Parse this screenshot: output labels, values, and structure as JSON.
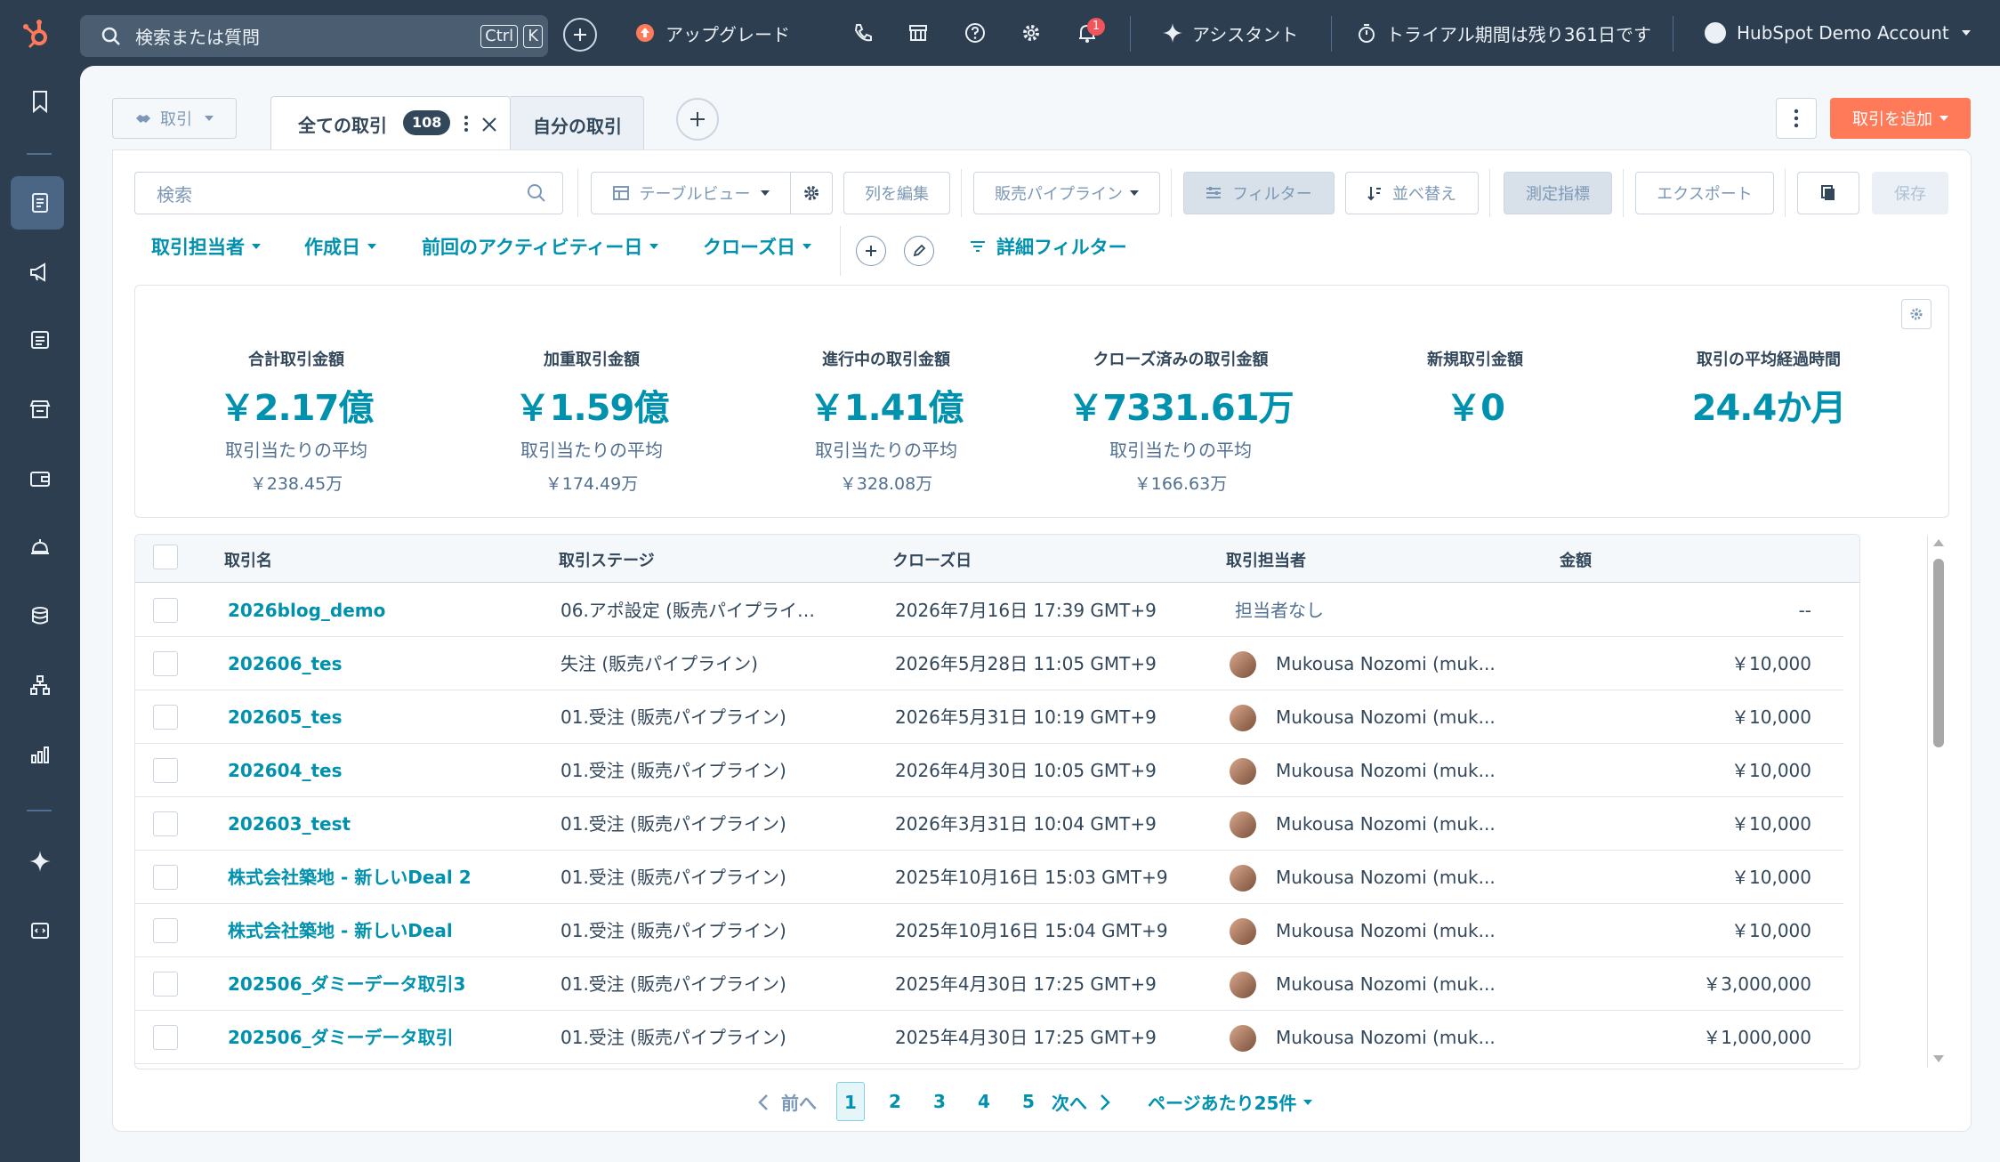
{
  "topbar": {
    "search_placeholder": "検索または質問",
    "kbd_ctrl": "Ctrl",
    "kbd_k": "K",
    "upgrade_label": "アップグレード",
    "notification_count": "1",
    "assistant_label": "アシスタント",
    "trial_label": "トライアル期間は残り361日です",
    "account_label": "HubSpot Demo Account"
  },
  "header": {
    "object_selector": "取引",
    "tabs": [
      {
        "label": "全ての取引",
        "count": "108"
      },
      {
        "label": "自分の取引"
      }
    ],
    "add_button": "取引を追加"
  },
  "toolbar": {
    "search_placeholder": "検索",
    "table_view": "テーブルビュー",
    "edit_columns": "列を編集",
    "pipeline": "販売パイプライン",
    "filter": "フィルター",
    "sort": "並べ替え",
    "metrics": "測定指標",
    "export": "エクスポート",
    "save": "保存"
  },
  "filters": {
    "owner": "取引担当者",
    "created": "作成日",
    "last_activity": "前回のアクティビティー日",
    "close_date": "クローズ日",
    "advanced": "詳細フィルター"
  },
  "kpis": [
    {
      "label": "合計取引金額",
      "value": "￥2.17億",
      "sub": "取引当たりの平均",
      "avg": "￥238.45万"
    },
    {
      "label": "加重取引金額",
      "value": "￥1.59億",
      "sub": "取引当たりの平均",
      "avg": "￥174.49万"
    },
    {
      "label": "進行中の取引金額",
      "value": "￥1.41億",
      "sub": "取引当たりの平均",
      "avg": "￥328.08万"
    },
    {
      "label": "クローズ済みの取引金額",
      "value": "￥7331.61万",
      "sub": "取引当たりの平均",
      "avg": "￥166.63万"
    },
    {
      "label": "新規取引金額",
      "value": "￥0",
      "sub": "",
      "avg": ""
    },
    {
      "label": "取引の平均経過時間",
      "value": "24.4か月",
      "sub": "",
      "avg": ""
    }
  ],
  "table": {
    "headers": {
      "name": "取引名",
      "stage": "取引ステージ",
      "close": "クローズ日",
      "owner": "取引担当者",
      "amount": "金額"
    },
    "rows": [
      {
        "name": "2026blog_demo",
        "stage": "06.アポ設定 (販売パイプライ…",
        "close": "2026年7月16日 17:39 GMT+9",
        "owner": "担当者なし",
        "amount": "--",
        "avatar": false
      },
      {
        "name": "202606_tes",
        "stage": "失注 (販売パイプライン)",
        "close": "2026年5月28日 11:05 GMT+9",
        "owner": "Mukousa Nozomi (muk...",
        "amount": "￥10,000",
        "avatar": true
      },
      {
        "name": "202605_tes",
        "stage": "01.受注 (販売パイプライン)",
        "close": "2026年5月31日 10:19 GMT+9",
        "owner": "Mukousa Nozomi (muk...",
        "amount": "￥10,000",
        "avatar": true
      },
      {
        "name": "202604_tes",
        "stage": "01.受注 (販売パイプライン)",
        "close": "2026年4月30日 10:05 GMT+9",
        "owner": "Mukousa Nozomi (muk...",
        "amount": "￥10,000",
        "avatar": true
      },
      {
        "name": "202603_test",
        "stage": "01.受注 (販売パイプライン)",
        "close": "2026年3月31日 10:04 GMT+9",
        "owner": "Mukousa Nozomi (muk...",
        "amount": "￥10,000",
        "avatar": true
      },
      {
        "name": "株式会社築地 - 新しいDeal 2",
        "stage": "01.受注 (販売パイプライン)",
        "close": "2025年10月16日 15:03 GMT+9",
        "owner": "Mukousa Nozomi (muk...",
        "amount": "￥10,000",
        "avatar": true
      },
      {
        "name": "株式会社築地 - 新しいDeal",
        "stage": "01.受注 (販売パイプライン)",
        "close": "2025年10月16日 15:04 GMT+9",
        "owner": "Mukousa Nozomi (muk...",
        "amount": "￥10,000",
        "avatar": true
      },
      {
        "name": "202506_ダミーデータ取引3",
        "stage": "01.受注 (販売パイプライン)",
        "close": "2025年4月30日 17:25 GMT+9",
        "owner": "Mukousa Nozomi (muk...",
        "amount": "￥3,000,000",
        "avatar": true
      },
      {
        "name": "202506_ダミーデータ取引",
        "stage": "01.受注 (販売パイプライン)",
        "close": "2025年4月30日 17:25 GMT+9",
        "owner": "Mukousa Nozomi (muk...",
        "amount": "￥1,000,000",
        "avatar": true
      }
    ]
  },
  "pagination": {
    "prev": "前へ",
    "next": "次へ",
    "pages": [
      "1",
      "2",
      "3",
      "4",
      "5"
    ],
    "current": "1",
    "per_page": "ページあたり25件"
  },
  "colors": {
    "accent": "#0091ae",
    "primary_button": "#ff7a59",
    "nav_bg": "#2d3e50"
  }
}
